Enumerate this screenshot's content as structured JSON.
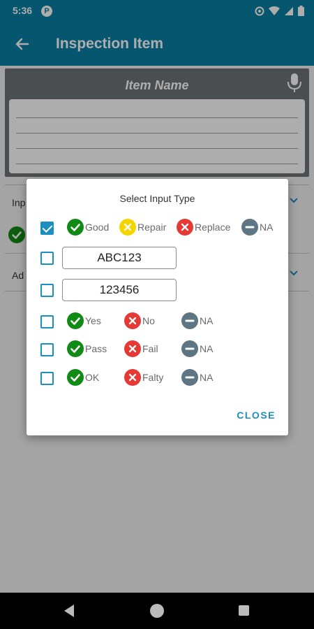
{
  "status_bar": {
    "time": "5:36",
    "app_icon_letter": "P"
  },
  "app_bar": {
    "title": "Inspection Item"
  },
  "background": {
    "item_name_label": "Item Name",
    "row1_label": "Inp",
    "row2_label": "Ad"
  },
  "dialog": {
    "title": "Select Input Type",
    "rows": [
      {
        "checked": true,
        "choices": [
          {
            "label": "Good",
            "icon": "check-icon",
            "color": "#128a16"
          },
          {
            "label": "Repair",
            "icon": "x-icon",
            "color": "#f5d500"
          },
          {
            "label": "Replace",
            "icon": "x-icon",
            "color": "#e53935"
          },
          {
            "label": "NA",
            "icon": "minus-icon",
            "color": "#5e7584"
          }
        ]
      },
      {
        "checked": false,
        "text_value": "ABC123"
      },
      {
        "checked": false,
        "text_value": "123456"
      },
      {
        "checked": false,
        "choices": [
          {
            "label": "Yes",
            "icon": "check-icon",
            "color": "#128a16"
          },
          {
            "label": "No",
            "icon": "x-icon",
            "color": "#e53935"
          },
          {
            "label": "NA",
            "icon": "minus-icon",
            "color": "#5e7584"
          }
        ]
      },
      {
        "checked": false,
        "choices": [
          {
            "label": "Pass",
            "icon": "check-icon",
            "color": "#128a16"
          },
          {
            "label": "Fail",
            "icon": "x-icon",
            "color": "#e53935"
          },
          {
            "label": "NA",
            "icon": "minus-icon",
            "color": "#5e7584"
          }
        ]
      },
      {
        "checked": false,
        "choices": [
          {
            "label": "OK",
            "icon": "check-icon",
            "color": "#128a16"
          },
          {
            "label": "Falty",
            "icon": "x-icon",
            "color": "#e53935"
          },
          {
            "label": "NA",
            "icon": "minus-icon",
            "color": "#5e7584"
          }
        ]
      }
    ],
    "close_label": "CLOSE"
  },
  "colors": {
    "primary": "#0a7fa6",
    "accent": "#1a8fc0"
  }
}
